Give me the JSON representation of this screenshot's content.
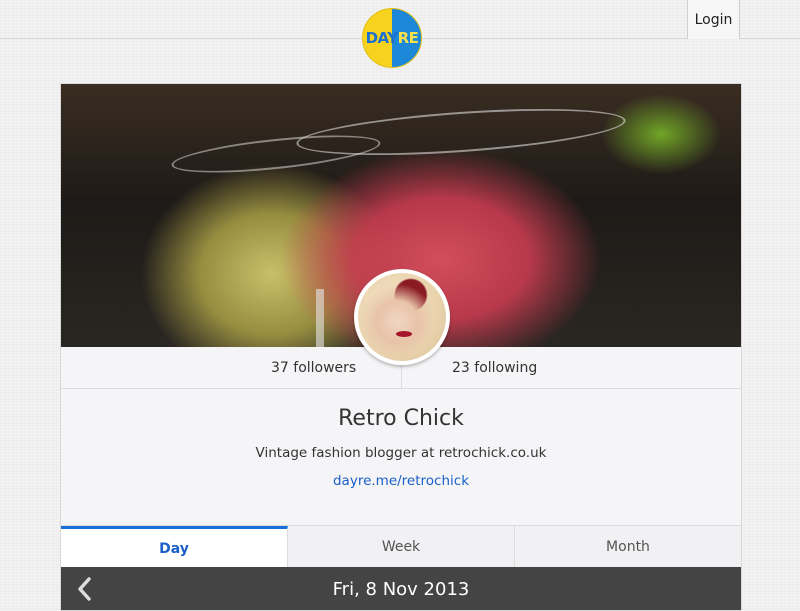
{
  "header": {
    "logo_text_a": "DAY",
    "logo_text_b": "RE",
    "login_label": "Login"
  },
  "profile": {
    "followers_label": "37 followers",
    "following_label": "23 following",
    "name": "Retro Chick",
    "bio": "Vintage fashion blogger at retrochick.co.uk",
    "link": "dayre.me/retrochick"
  },
  "tabs": [
    {
      "label": "Day",
      "active": true
    },
    {
      "label": "Week",
      "active": false
    },
    {
      "label": "Month",
      "active": false
    }
  ],
  "datebar": {
    "date": "Fri, 8 Nov 2013",
    "back_icon": "chevron-left-icon"
  },
  "colors": {
    "accent": "#1a6fd8",
    "logo_yellow": "#f7d21e",
    "logo_blue": "#1e88d8",
    "datebar_bg": "#444444"
  }
}
